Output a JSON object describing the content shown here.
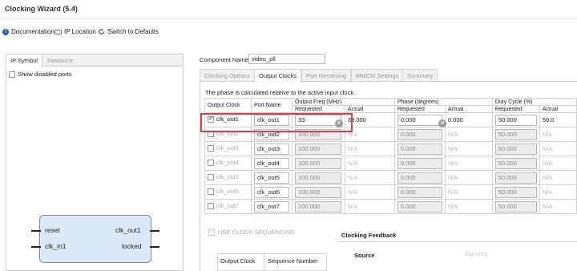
{
  "window": {
    "title": "Clocking Wizard (5.4)"
  },
  "toolbar": {
    "documentation": "Documentation",
    "ip_location": "IP Location",
    "switch_defaults": "Switch to Defaults"
  },
  "left_panel": {
    "tabs": [
      "IP Symbol",
      "Resource"
    ],
    "show_disabled_ports": "Show disabled ports",
    "symbol": {
      "left_ports": [
        "reset",
        "clk_in1"
      ],
      "right_ports": [
        "clk_out1",
        "locked"
      ]
    }
  },
  "component": {
    "label": "Component Name",
    "value": "video_pll"
  },
  "tabs": [
    "Clocking Options",
    "Output Clocks",
    "Port Renaming",
    "MMCM Settings",
    "Summary"
  ],
  "active_tab": "Output Clocks",
  "phase_note": "The phase is calculated relative to the active input clock.",
  "table": {
    "headers": {
      "output_clock": "Output Clock",
      "port_name": "Port Name",
      "freq_group": "Output Freq (MHz)",
      "phase_group": "Phase (degrees)",
      "duty_group": "Duty Cycle (%)",
      "requested": "Requested",
      "actual": "Actual"
    },
    "rows": [
      {
        "clock": "clk_out1",
        "checked": true,
        "port": "clk_out1",
        "freq_req": "33",
        "freq_act": "33.000",
        "phase_req": "0.000",
        "phase_act": "0.000",
        "duty_req": "50.000",
        "duty_act": "50.0"
      },
      {
        "clock": "clk_out2",
        "checked": false,
        "port": "clk_out2",
        "freq_req": "100.000",
        "freq_act": "N/A",
        "phase_req": "0.000",
        "phase_act": "N/A",
        "duty_req": "50.000",
        "duty_act": "N/A"
      },
      {
        "clock": "clk_out3",
        "checked": false,
        "port": "clk_out3",
        "freq_req": "100.000",
        "freq_act": "N/A",
        "phase_req": "0.000",
        "phase_act": "N/A",
        "duty_req": "50.000",
        "duty_act": "N/A"
      },
      {
        "clock": "clk_out4",
        "checked": false,
        "port": "clk_out4",
        "freq_req": "100.000",
        "freq_act": "N/A",
        "phase_req": "0.000",
        "phase_act": "N/A",
        "duty_req": "50.000",
        "duty_act": "N/A"
      },
      {
        "clock": "clk_out5",
        "checked": false,
        "port": "clk_out5",
        "freq_req": "100.000",
        "freq_act": "N/A",
        "phase_req": "0.000",
        "phase_act": "N/A",
        "duty_req": "50.000",
        "duty_act": "N/A"
      },
      {
        "clock": "clk_out6",
        "checked": false,
        "port": "clk_out6",
        "freq_req": "100.000",
        "freq_act": "N/A",
        "phase_req": "0.000",
        "phase_act": "N/A",
        "duty_req": "50.000",
        "duty_act": "N/A"
      },
      {
        "clock": "clk_out7",
        "checked": false,
        "port": "clk_out7",
        "freq_req": "100.000",
        "freq_act": "N/A",
        "phase_req": "0.000",
        "phase_act": "N/A",
        "duty_req": "50.000",
        "duty_act": "N/A"
      }
    ]
  },
  "clock_sequencing": "USE CLOCK SEQUENCING",
  "sequence_table": {
    "col1": "Output Clock",
    "col2": "Sequence Number"
  },
  "feedback": {
    "title": "Clocking Feedback",
    "source": "Source",
    "signaling": "Signaling"
  },
  "colors": {
    "highlight": "#e0393e",
    "symbol_fill": "#dce9f7",
    "symbol_border": "#6e8fb3",
    "info_icon": "#1f5fa8"
  }
}
